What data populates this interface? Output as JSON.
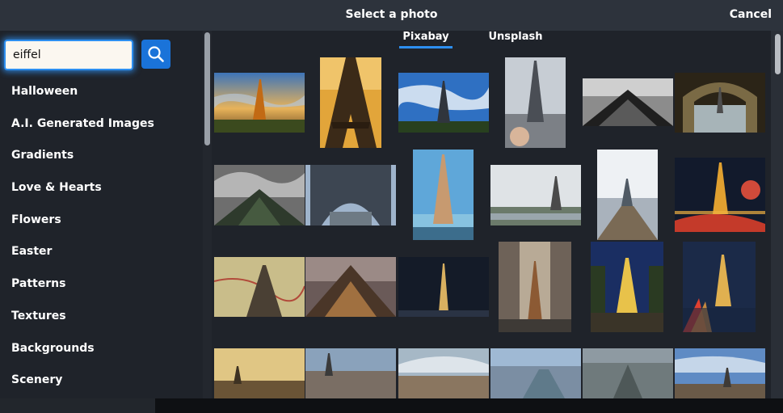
{
  "header": {
    "title": "Select a photo",
    "cancel_label": "Cancel"
  },
  "search": {
    "value": "eiffel"
  },
  "sidebar": {
    "categories": [
      "Halloween",
      "A.I. Generated Images",
      "Gradients",
      "Love & Hearts",
      "Flowers",
      "Easter",
      "Patterns",
      "Textures",
      "Backgrounds",
      "Scenery"
    ]
  },
  "tabs": [
    {
      "label": "Pixabay",
      "active": true
    },
    {
      "label": "Unsplash",
      "active": false
    }
  ],
  "colors": {
    "accent": "#2d8ff0",
    "search_button": "#1a73d9",
    "background": "#1f232a",
    "header": "#2d333c"
  },
  "icons": {
    "search_button": "search-icon"
  }
}
